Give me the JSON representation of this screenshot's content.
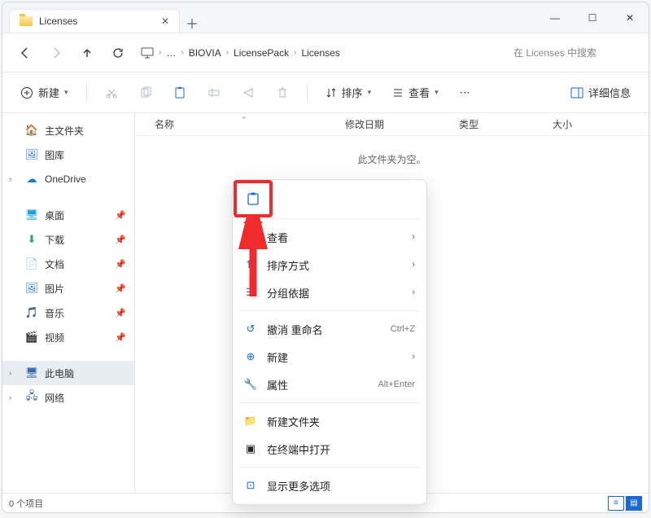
{
  "window": {
    "title": "Licenses"
  },
  "nav": {
    "crumbs": [
      "BIOVIA",
      "LicensePack",
      "Licenses"
    ],
    "search_placeholder": "在 Licenses 中搜索"
  },
  "toolbar": {
    "new": "新建",
    "sort": "排序",
    "view": "查看",
    "details": "详细信息"
  },
  "sidebar": {
    "home": "主文件夹",
    "gallery": "图库",
    "onedrive": "OneDrive",
    "desktop": "桌面",
    "downloads": "下载",
    "documents": "文档",
    "pictures": "图片",
    "music": "音乐",
    "videos": "视频",
    "thispc": "此电脑",
    "network": "网络"
  },
  "columns": {
    "name": "名称",
    "date": "修改日期",
    "type": "类型",
    "size": "大小"
  },
  "content": {
    "empty": "此文件夹为空。"
  },
  "context": {
    "view": "查看",
    "sort": "排序方式",
    "group": "分组依据",
    "undo_rename": "撤消 重命名",
    "undo_sc": "Ctrl+Z",
    "new": "新建",
    "properties": "属性",
    "prop_sc": "Alt+Enter",
    "new_folder": "新建文件夹",
    "terminal": "在终端中打开",
    "more": "显示更多选项"
  },
  "status": {
    "items": "0 个项目"
  }
}
